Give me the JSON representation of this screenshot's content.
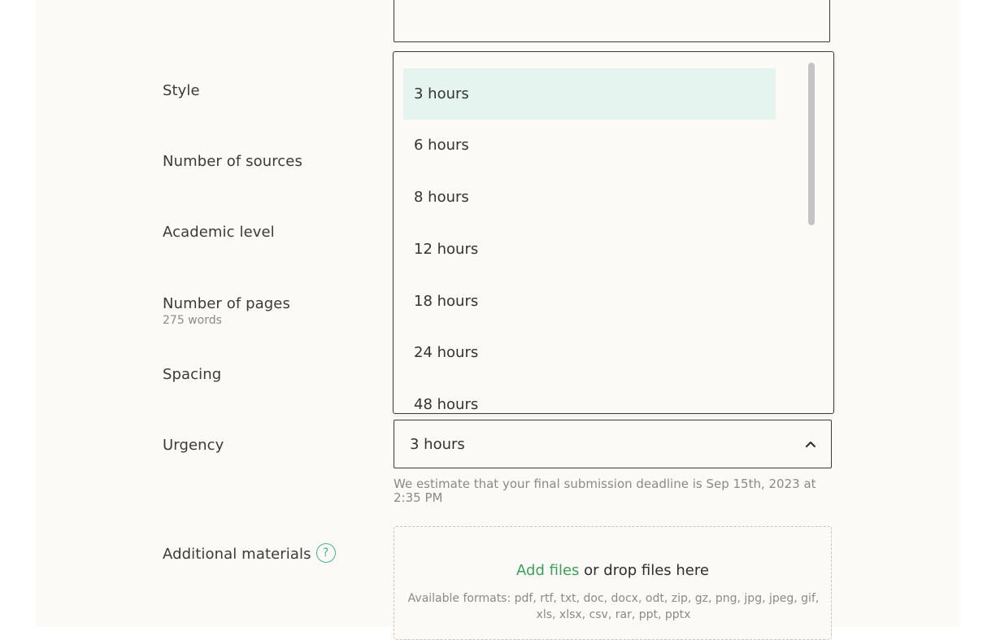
{
  "form": {
    "labels": {
      "style": "Style",
      "sources": "Number of sources",
      "academic_level": "Academic level",
      "pages": "Number of pages",
      "pages_sub": "275 words",
      "spacing": "Spacing",
      "urgency": "Urgency",
      "additional_materials": "Additional materials"
    },
    "help_icon": "?",
    "urgency": {
      "selected": "3 hours",
      "options": [
        "3 hours",
        "6 hours",
        "8 hours",
        "12 hours",
        "18 hours",
        "24 hours",
        "48 hours"
      ],
      "chevron_icon": "chevron-up-icon",
      "hint": "We estimate that your final submission deadline is Sep 15th, 2023 at 2:35 PM"
    },
    "upload": {
      "link": "Add files",
      "text": " or drop files here",
      "formats": "Available formats: pdf, rtf, txt, doc, docx, odt, zip, gz, png, jpg, jpeg, gif, xls, xlsx, csv, rar, ppt, pptx"
    }
  },
  "colors": {
    "accent": "#3f9e5a",
    "selected_bg": "#e6f4ef",
    "panel_bg": "#fcfaf7"
  }
}
